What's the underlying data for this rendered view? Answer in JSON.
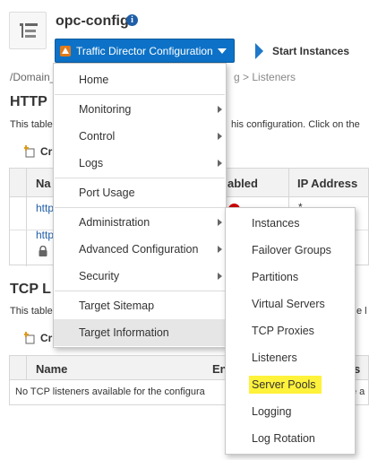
{
  "header": {
    "title": "opc-config",
    "info_icon": "i",
    "menu_button_label": "Traffic Director Configuration",
    "train_next_label": "Start Instances"
  },
  "breadcrumb": {
    "start": "/Domain_",
    "tail": "g > Listeners"
  },
  "http_section": {
    "title_visible": "HTTP",
    "desc_left": "This table",
    "desc_right": "his configuration. Click on the",
    "create_label": "Cr",
    "columns_visible": [
      "Na",
      "abled",
      "IP Address"
    ],
    "rows": [
      {
        "name_visible": "http",
        "ip": "*",
        "status": "error"
      },
      {
        "name_visible": "http",
        "ip": "",
        "status": "locked"
      }
    ]
  },
  "tcp_section": {
    "title_visible": "TCP L",
    "desc_left": "This table",
    "desc_right": "e l",
    "create_label": "Cr",
    "columns_visible": [
      "Name",
      "En",
      "s"
    ],
    "empty_message_visible": "No TCP listeners available for the configura",
    "empty_message_tail": "e a"
  },
  "menu": {
    "items": [
      {
        "label": "Home",
        "has_submenu": false
      },
      {
        "label": "Monitoring",
        "has_submenu": true
      },
      {
        "label": "Control",
        "has_submenu": true
      },
      {
        "label": "Logs",
        "has_submenu": true
      },
      {
        "label": "Port Usage",
        "has_submenu": false
      },
      {
        "label": "Administration",
        "has_submenu": true
      },
      {
        "label": "Advanced Configuration",
        "has_submenu": true
      },
      {
        "label": "Security",
        "has_submenu": true
      },
      {
        "label": "Target Sitemap",
        "has_submenu": false
      },
      {
        "label": "Target Information",
        "has_submenu": false
      }
    ]
  },
  "submenu": {
    "items": [
      {
        "label": "Instances"
      },
      {
        "label": "Failover Groups"
      },
      {
        "label": "Partitions"
      },
      {
        "label": "Virtual Servers"
      },
      {
        "label": "TCP Proxies"
      },
      {
        "label": "Listeners"
      },
      {
        "label": "Server Pools"
      },
      {
        "label": "Logging"
      },
      {
        "label": "Log Rotation"
      }
    ],
    "highlighted": "Server Pools"
  },
  "colors": {
    "accent": "#0d72c7",
    "link": "#1f5ea8",
    "highlight": "#fff23a",
    "error": "#cc0000"
  },
  "icons": {
    "target_icon": "target-type-icon",
    "create_icon": "create-plus-icon",
    "lock_icon": "lock-icon",
    "error_icon": "error-icon"
  }
}
